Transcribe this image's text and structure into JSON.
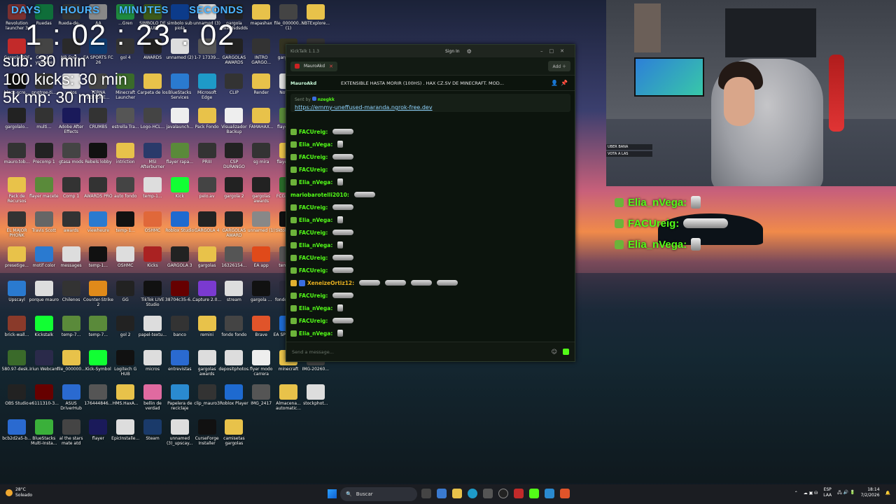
{
  "countdown": {
    "labels": [
      "DAYS",
      "HOURS",
      "MINUTES",
      "SECONDS"
    ],
    "time": "1 : 02 : 23 : 02",
    "goals": [
      "sub: 30 min",
      "100 kicks: 30 min",
      "5k mp: 30 min"
    ]
  },
  "desktop_icons": [
    {
      "label": "Revolution launcher 3",
      "color": "#7a3030"
    },
    {
      "label": "Ruedas",
      "color": "#0f6e3a"
    },
    {
      "label": "Rueda-de-...",
      "color": "#333"
    },
    {
      "label": "AA",
      "color": "#888"
    },
    {
      "label": "...Gren",
      "color": "#1e8a3e"
    },
    {
      "label": "SIMBOLO DE SUB",
      "color": "#3d5a1a"
    },
    {
      "label": "simbolo sub piola",
      "color": "#0c3b8a"
    },
    {
      "label": "unnamed (3)",
      "color": "#ddd"
    },
    {
      "label": "gargola awardsdsdds",
      "color": "#222"
    },
    {
      "label": "mapashax",
      "color": "#e8c24a"
    },
    {
      "label": "file_000000... (1)",
      "color": "#444"
    },
    {
      "label": "NBTExplore...",
      "color": "#e8c24a"
    },
    {
      "label": "Gargola PDF",
      "color": "#c22a2a"
    },
    {
      "label": "Canal 5 youtube",
      "color": "#444"
    },
    {
      "label": "NB-Free...",
      "color": "#2a2a2a"
    },
    {
      "label": "EA SPORTS FC 26",
      "color": "#0e3a6e"
    },
    {
      "label": "gol 4",
      "color": "#333"
    },
    {
      "label": "AWARDS",
      "color": "#222"
    },
    {
      "label": "unnamed (2)",
      "color": "#ddd"
    },
    {
      "label": "1-7 17339...",
      "color": "#555"
    },
    {
      "label": "GARGOLAS AWARDS",
      "color": "#222"
    },
    {
      "label": "INTRO GARGO...",
      "color": "#333"
    },
    {
      "label": "gargolaws",
      "color": "#332"
    },
    {
      "label": "R",
      "color": "#333"
    },
    {
      "label": "black-scre...",
      "color": "#111"
    },
    {
      "label": "pngtree-ti...",
      "color": "#333"
    },
    {
      "label": "votos",
      "color": "#ddd"
    },
    {
      "label": "TERNA EDITORE...",
      "color": "#444"
    },
    {
      "label": "Minecraft Launcher",
      "color": "#3a6a2a"
    },
    {
      "label": "Carpeta de los",
      "color": "#e8c24a"
    },
    {
      "label": "BlueStacks Services",
      "color": "#2a7ad0"
    },
    {
      "label": "Microsoft Edge",
      "color": "#1e9ac8"
    },
    {
      "label": "CLIP",
      "color": "#333"
    },
    {
      "label": "Render",
      "color": "#e8c24a"
    },
    {
      "label": "Notepad",
      "color": "#ddd"
    },
    {
      "label": "future...",
      "color": "#ddd"
    },
    {
      "label": "gargolalo...",
      "color": "#222"
    },
    {
      "label": "multi...",
      "color": "#333"
    },
    {
      "label": "Adobe After Effects",
      "color": "#1a1a5a"
    },
    {
      "label": "CRUMBS",
      "color": "#333"
    },
    {
      "label": "estrella Tra...",
      "color": "#555"
    },
    {
      "label": "Logo-HCL...",
      "color": "#444"
    },
    {
      "label": "javalaunch...",
      "color": "#eee"
    },
    {
      "label": "Pack Fondo",
      "color": "#e8c24a"
    },
    {
      "label": "Visualizador Backup",
      "color": "#eee"
    },
    {
      "label": "FAMAHAX...",
      "color": "#e8c24a"
    },
    {
      "label": "flayer.raya",
      "color": "#5a8a3a"
    },
    {
      "label": "Clase... (Prm...)",
      "color": "#ddd"
    },
    {
      "label": "mauro.tob...",
      "color": "#333"
    },
    {
      "label": "Precomp 1",
      "color": "#222"
    },
    {
      "label": "gtasa mods",
      "color": "#444"
    },
    {
      "label": "Rebels lobby",
      "color": "#111"
    },
    {
      "label": "intriction",
      "color": "#e8c24a"
    },
    {
      "label": "MSI Afterburner",
      "color": "#2a3a6a"
    },
    {
      "label": "flayer rapa...",
      "color": "#5a8a3a"
    },
    {
      "label": "PRIII",
      "color": "#333"
    },
    {
      "label": "CSP DURANGO",
      "color": "#222"
    },
    {
      "label": "sg mira",
      "color": "#333"
    },
    {
      "label": "flayer_AME",
      "color": "#e8c24a"
    },
    {
      "label": "black-back...",
      "color": "#111"
    },
    {
      "label": "Pack de Recursos",
      "color": "#e8c24a"
    },
    {
      "label": "flayer macete",
      "color": "#5a8a3a"
    },
    {
      "label": "Comp 1",
      "color": "#333"
    },
    {
      "label": "AWARDS PRO",
      "color": "#333"
    },
    {
      "label": "auto fondo",
      "color": "#444"
    },
    {
      "label": "temp-1...",
      "color": "#ddd"
    },
    {
      "label": "Kick",
      "color": "#1f3"
    },
    {
      "label": "pelo.av",
      "color": "#444"
    },
    {
      "label": "gargola 2",
      "color": "#222"
    },
    {
      "label": "gargolas awards",
      "color": "#222"
    },
    {
      "label": "FCGames...",
      "color": "#2a6a2a"
    },
    {
      "label": "carr_ups...",
      "color": "#555"
    },
    {
      "label": "EL MAJOR PHONK",
      "color": "#333"
    },
    {
      "label": "Travis Scott",
      "color": "#666"
    },
    {
      "label": "awards",
      "color": "#333"
    },
    {
      "label": "viewheure",
      "color": "#2a7ad0"
    },
    {
      "label": "temp-1...",
      "color": "#111"
    },
    {
      "label": "OSHMC",
      "color": "#e0683a"
    },
    {
      "label": "Roblox Studio",
      "color": "#1e6ad0"
    },
    {
      "label": "GARGOLA 4",
      "color": "#222"
    },
    {
      "label": "GARGOLAS AWARD",
      "color": "#222"
    },
    {
      "label": "unnamed (1)",
      "color": "#888"
    },
    {
      "label": "tiktok-icon...",
      "color": "#111"
    },
    {
      "label": "DESGARGA...",
      "color": "#c22a2a"
    },
    {
      "label": "presetige...",
      "color": "#e8c24a"
    },
    {
      "label": "motif color",
      "color": "#2a7ad0"
    },
    {
      "label": "messages",
      "color": "#ddd"
    },
    {
      "label": "temp-1...",
      "color": "#111"
    },
    {
      "label": "OSHMC",
      "color": "#ddd"
    },
    {
      "label": "Kicks",
      "color": "#a22"
    },
    {
      "label": "GARGOLA 3",
      "color": "#222"
    },
    {
      "label": "gargolas",
      "color": "#e8c24a"
    },
    {
      "label": "16326154...",
      "color": "#555"
    },
    {
      "label": "EA app",
      "color": "#e04a1a"
    },
    {
      "label": "temp-1...",
      "color": "#555"
    },
    {
      "label": "flayer para ...",
      "color": "#e8c24a"
    },
    {
      "label": "Upscayl",
      "color": "#2a7ad0"
    },
    {
      "label": "porque mauro",
      "color": "#ddd"
    },
    {
      "label": "Chilenos",
      "color": "#333"
    },
    {
      "label": "Counter-Strike 2",
      "color": "#e08a1a"
    },
    {
      "label": "GG",
      "color": "#222"
    },
    {
      "label": "TikTok LIVE Studio",
      "color": "#111"
    },
    {
      "label": "38704c35-6...",
      "color": "#600"
    },
    {
      "label": "Capture 2.0...",
      "color": "#7a3ad0"
    },
    {
      "label": "stream",
      "color": "#ddd"
    },
    {
      "label": "gargola ...",
      "color": "#111"
    },
    {
      "label": "fondo-abst...",
      "color": "#2a2a3a"
    },
    {
      "label": "banner roobet",
      "color": "#333"
    },
    {
      "label": "brick-wall...",
      "color": "#8a3a2a"
    },
    {
      "label": "Kickstalk",
      "color": "#1f3"
    },
    {
      "label": "temp-7...",
      "color": "#5a8a3a"
    },
    {
      "label": "temp-7...",
      "color": "#5a8a3a"
    },
    {
      "label": "gol 2",
      "color": "#222"
    },
    {
      "label": "papel-textu...",
      "color": "#ddd"
    },
    {
      "label": "banco",
      "color": "#333"
    },
    {
      "label": "remini",
      "color": "#e8c24a"
    },
    {
      "label": "fondo fondo",
      "color": "#444"
    },
    {
      "label": "Brave",
      "color": "#e0542a"
    },
    {
      "label": "EA SPORTS FC 26",
      "color": "#1e6ad0"
    },
    {
      "label": "MasterHom...",
      "color": "#2a8ad0"
    },
    {
      "label": "580.97-desk...",
      "color": "#3a6a2a"
    },
    {
      "label": "Iriun Webcam",
      "color": "#2a2a4a"
    },
    {
      "label": "file_000000...",
      "color": "#e8c24a"
    },
    {
      "label": "Kick-Symbol",
      "color": "#1f3"
    },
    {
      "label": "Logitech G HUB",
      "color": "#111"
    },
    {
      "label": "micros",
      "color": "#ddd"
    },
    {
      "label": "entrevistas",
      "color": "#2a6ad0"
    },
    {
      "label": "gargolas awards",
      "color": "#ddd"
    },
    {
      "label": "depositphotos...",
      "color": "#ddd"
    },
    {
      "label": "flyer modo carrera",
      "color": "#eee"
    },
    {
      "label": "minecraft",
      "color": "#e8c24a"
    },
    {
      "label": "IMG-20260...",
      "color": "#444"
    },
    {
      "label": "OBS Studio",
      "color": "#222"
    },
    {
      "label": "e6111310-3...",
      "color": "#600"
    },
    {
      "label": "ASUS DriverHub",
      "color": "#2a6ad0"
    },
    {
      "label": "176444846...",
      "color": "#555"
    },
    {
      "label": "HMS.HaxA...",
      "color": "#e8c24a"
    },
    {
      "label": "bellin de verdad",
      "color": "#e06aa0"
    },
    {
      "label": "Papelera de reciclaje",
      "color": "#2a8ad0"
    },
    {
      "label": "clip_mauro3",
      "color": "#333"
    },
    {
      "label": "Roblox Player",
      "color": "#1e6ad0"
    },
    {
      "label": "IMG_2417",
      "color": "#555"
    },
    {
      "label": "Almacena... automatic...",
      "color": "#e8c24a"
    },
    {
      "label": "stockphot...",
      "color": "#ddd"
    },
    {
      "label": "bcb2d2a5-b...",
      "color": "#2a6ad0"
    },
    {
      "label": "BlueStacks Multi-Insta...",
      "color": "#3ab03a"
    },
    {
      "label": "al the stars mate atd",
      "color": "#444"
    },
    {
      "label": "flayer",
      "color": "#1a1a5a"
    },
    {
      "label": "EpicInstalle...",
      "color": "#ddd"
    },
    {
      "label": "Steam",
      "color": "#1a3a6a"
    },
    {
      "label": "unnamed (3)_upscay...",
      "color": "#ddd"
    },
    {
      "label": "CurseForge Installer",
      "color": "#111"
    },
    {
      "label": "camisetas gargolas",
      "color": "#e8c24a"
    }
  ],
  "chat_window": {
    "window_title": "KickTalk 1.1.3",
    "sign_in": "Sign In",
    "tab": "MauroAkd",
    "add": "Add",
    "channel_name": "MauroAkd",
    "stream_title": "EXTENSIBLE HASTA MORIR (100HS) . HAX CZ.SV DE MINECRAFT. MOD...",
    "pinned_sent_by": "Sent by",
    "pinned_user": "nzegkk",
    "pinned_link": "https://emmy-uneffused-maranda.ngrok-free.dev",
    "messages": [
      {
        "user": "FACUreig:",
        "color": "#53fc18",
        "badge": "green",
        "emote": "wide",
        "count": 1
      },
      {
        "user": "Elia_nVega:",
        "color": "#53fc18",
        "badge": "green",
        "emote": "small",
        "count": 1
      },
      {
        "user": "FACUreig:",
        "color": "#53fc18",
        "badge": "green",
        "emote": "wide",
        "count": 1
      },
      {
        "user": "FACUreig:",
        "color": "#53fc18",
        "badge": "green",
        "emote": "wide",
        "count": 1
      },
      {
        "user": "Elia_nVega:",
        "color": "#53fc18",
        "badge": "green",
        "emote": "small",
        "count": 1
      },
      {
        "user": "mariobarotelli2010:",
        "color": "#53fc18",
        "badge": "none",
        "emote": "wide",
        "count": 1
      },
      {
        "user": "FACUreig:",
        "color": "#53fc18",
        "badge": "green",
        "emote": "wide",
        "count": 1
      },
      {
        "user": "Elia_nVega:",
        "color": "#53fc18",
        "badge": "green",
        "emote": "small",
        "count": 1
      },
      {
        "user": "FACUreig:",
        "color": "#53fc18",
        "badge": "green",
        "emote": "wide",
        "count": 1
      },
      {
        "user": "Elia_nVega:",
        "color": "#53fc18",
        "badge": "green",
        "emote": "small",
        "count": 1
      },
      {
        "user": "FACUreig:",
        "color": "#53fc18",
        "badge": "green",
        "emote": "wide",
        "count": 1
      },
      {
        "user": "FACUreig:",
        "color": "#53fc18",
        "badge": "green",
        "emote": "wide",
        "count": 1
      },
      {
        "user": "XeneizeOrtiz12:",
        "color": "#e8b020",
        "badge": "gold",
        "emote": "wide",
        "count": 4
      },
      {
        "user": "FACUreig:",
        "color": "#53fc18",
        "badge": "green",
        "emote": "wide",
        "count": 1
      },
      {
        "user": "Elia_nVega:",
        "color": "#53fc18",
        "badge": "green",
        "emote": "small",
        "count": 1
      },
      {
        "user": "FACUreig:",
        "color": "#53fc18",
        "badge": "green",
        "emote": "wide",
        "count": 1
      },
      {
        "user": "Elia_nVega:",
        "color": "#53fc18",
        "badge": "green",
        "emote": "small",
        "count": 1
      }
    ],
    "input_placeholder": "Send a message..."
  },
  "cam_chat": [
    "UBER BANA",
    "VOTA A LAS"
  ],
  "overlay_chat": [
    {
      "user": "Elia_nVega:",
      "emote": "small"
    },
    {
      "user": "FACUreig:",
      "emote": "wide"
    },
    {
      "user": "Elia_nVega:",
      "emote": "small"
    }
  ],
  "taskbar": {
    "weather_temp": "28°C",
    "weather_desc": "Soleado",
    "search_label": "Buscar",
    "lang": "ESP",
    "lang2": "LAA",
    "time": "18:14",
    "date": "7/2/2026"
  },
  "colors": {
    "countdown_label": "#4ab3ff",
    "kick_green": "#53fc18",
    "link": "#8fd4ff"
  }
}
